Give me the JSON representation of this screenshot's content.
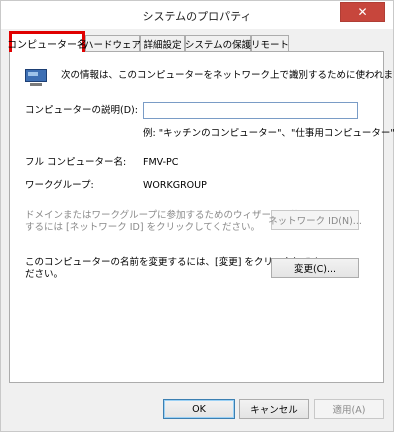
{
  "window": {
    "title": "システムのプロパティ",
    "close_icon": "close-icon"
  },
  "tabs": [
    {
      "label": "コンピューター名",
      "active": true
    },
    {
      "label": "ハードウェア",
      "active": false
    },
    {
      "label": "詳細設定",
      "active": false
    },
    {
      "label": "システムの保護",
      "active": false
    },
    {
      "label": "リモート",
      "active": false
    }
  ],
  "content": {
    "intro": "次の情報は、このコンピューターをネットワーク上で識別するために使われます。",
    "description_label": "コンピューターの説明(D):",
    "description_value": "",
    "description_example": "例: \"キッチンのコンピューター\"、\"仕事用コンピューター\"",
    "full_name_label": "フル コンピューター名:",
    "full_name_value": "FMV-PC",
    "workgroup_label": "ワークグループ:",
    "workgroup_value": "WORKGROUP",
    "network_note_line1": "ドメインまたはワークグループに参加するためのウィザードを使用",
    "network_note_line2": "するには [ネットワーク ID] をクリックしてください。",
    "network_id_button": "ネットワーク ID(N)...",
    "rename_note_line1": "このコンピューターの名前を変更するには、[変更] をクリックしてく",
    "rename_note_line2": "ださい。",
    "change_button": "変更(C)..."
  },
  "footer": {
    "ok": "OK",
    "cancel": "キャンセル",
    "apply": "適用(A)"
  },
  "colors": {
    "highlight": "#e00000",
    "panel_bg": "#ffffff",
    "window_bg": "#f0f0f0",
    "close_bg": "#c7463c"
  }
}
